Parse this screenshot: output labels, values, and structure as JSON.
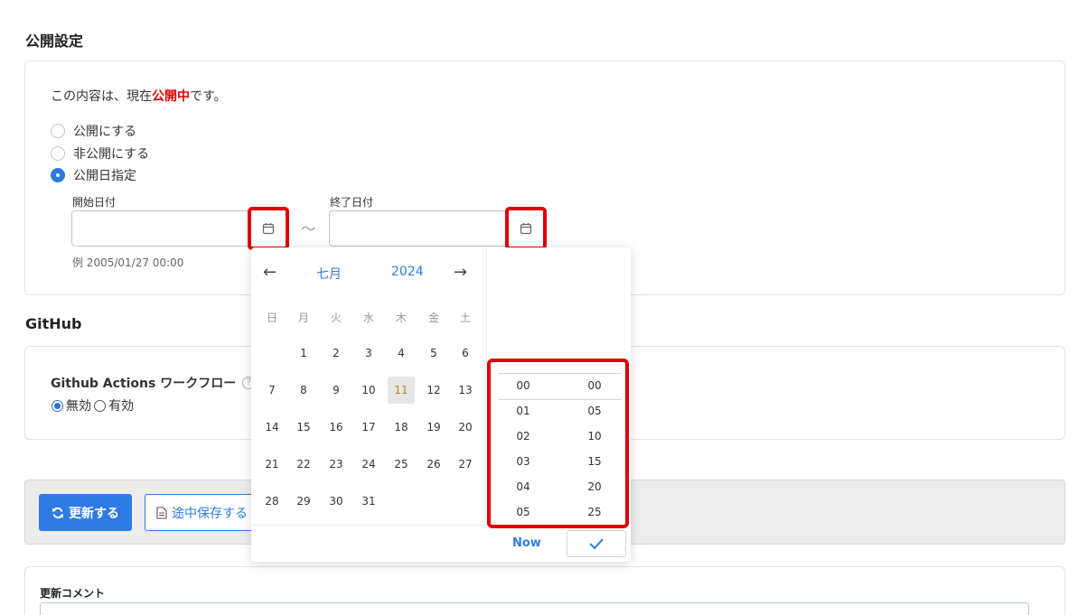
{
  "publish": {
    "title": "公開設定",
    "status_prefix": "この内容は、現在",
    "status_highlight": "公開中",
    "status_suffix": "です。",
    "options": [
      {
        "label": "公開にする",
        "checked": false
      },
      {
        "label": "非公開にする",
        "checked": false
      },
      {
        "label": "公開日指定",
        "checked": true
      }
    ],
    "start_label": "開始日付",
    "end_label": "終了日付",
    "start_value": "",
    "end_value": "",
    "range_separator": "〜",
    "hint": "例 2005/01/27 00:00"
  },
  "github": {
    "title": "GitHub",
    "workflow_label": "Github Actions ワークフロー",
    "help_symbol": "?",
    "options": [
      {
        "label": "無効",
        "checked": true
      },
      {
        "label": "有効",
        "checked": false
      }
    ]
  },
  "actions": {
    "update_label": "更新する",
    "draft_label": "途中保存する"
  },
  "comment": {
    "label": "更新コメント"
  },
  "datepicker": {
    "prev_arrow": "←",
    "next_arrow": "→",
    "month": "七月",
    "year": "2024",
    "weekdays": [
      "日",
      "月",
      "火",
      "水",
      "木",
      "金",
      "土"
    ],
    "weeks": [
      [
        "",
        "1",
        "2",
        "3",
        "4",
        "5",
        "6"
      ],
      [
        "7",
        "8",
        "9",
        "10",
        "11",
        "12",
        "13"
      ],
      [
        "14",
        "15",
        "16",
        "17",
        "18",
        "19",
        "20"
      ],
      [
        "21",
        "22",
        "23",
        "24",
        "25",
        "26",
        "27"
      ],
      [
        "28",
        "29",
        "30",
        "31",
        "",
        "",
        ""
      ]
    ],
    "today": "11",
    "hours": [
      "00",
      "01",
      "02",
      "03",
      "04",
      "05"
    ],
    "minutes": [
      "00",
      "05",
      "10",
      "15",
      "20",
      "25"
    ],
    "selected_hour": "00",
    "selected_minute": "00",
    "now_label": "Now",
    "confirm_icon": "check-icon"
  },
  "colors": {
    "accent": "#2f7be5",
    "highlight_red": "#e30000",
    "annotation_red": "#e00000"
  }
}
